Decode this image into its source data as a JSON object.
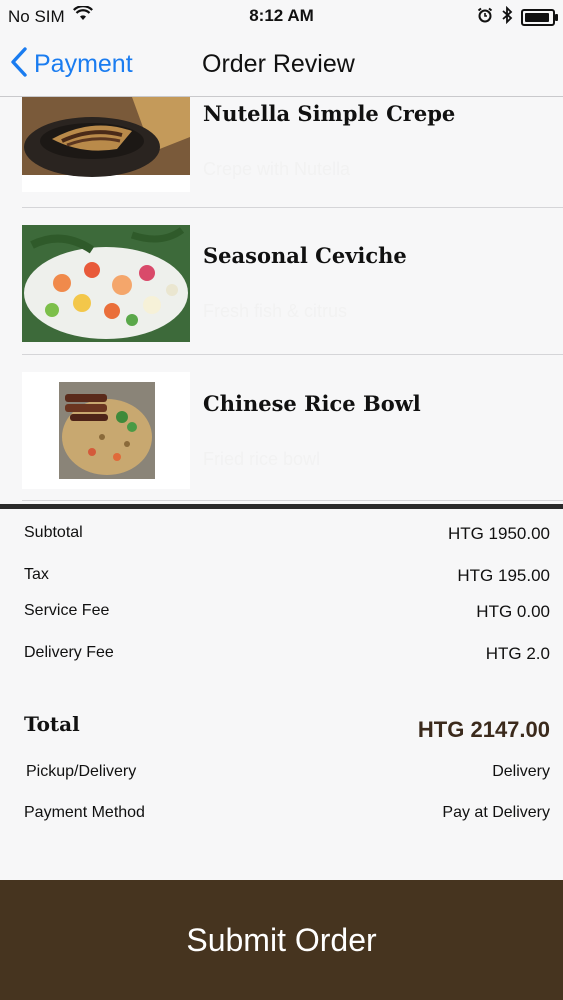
{
  "status_bar": {
    "carrier": "No SIM",
    "time": "8:12 AM"
  },
  "nav": {
    "back_label": "Payment",
    "title": "Order Review"
  },
  "items": [
    {
      "name": "Nutella Simple Crepe",
      "desc": "Crepe with Nutella"
    },
    {
      "name": "Seasonal Ceviche",
      "desc": "Fresh fish & citrus"
    },
    {
      "name": "Chinese Rice Bowl",
      "desc": "Fried rice bowl"
    }
  ],
  "summary": {
    "subtotal_label": "Subtotal",
    "subtotal_value": "HTG 1950.00",
    "tax_label": "Tax",
    "tax_value": "HTG 195.00",
    "service_label": "Service Fee",
    "service_value": "HTG 0.00",
    "delivery_label": "Delivery Fee",
    "delivery_value": "HTG 2.0",
    "total_label": "Total",
    "total_value": "HTG 2147.00",
    "pickup_label": "Pickup/Delivery",
    "pickup_value": "Delivery",
    "payment_label": "Payment Method",
    "payment_value": "Pay at Delivery"
  },
  "submit_label": "Submit Order",
  "colors": {
    "accent": "#1a7cf0",
    "brand_brown": "#46341f",
    "total_brown": "#3b2a1c"
  }
}
